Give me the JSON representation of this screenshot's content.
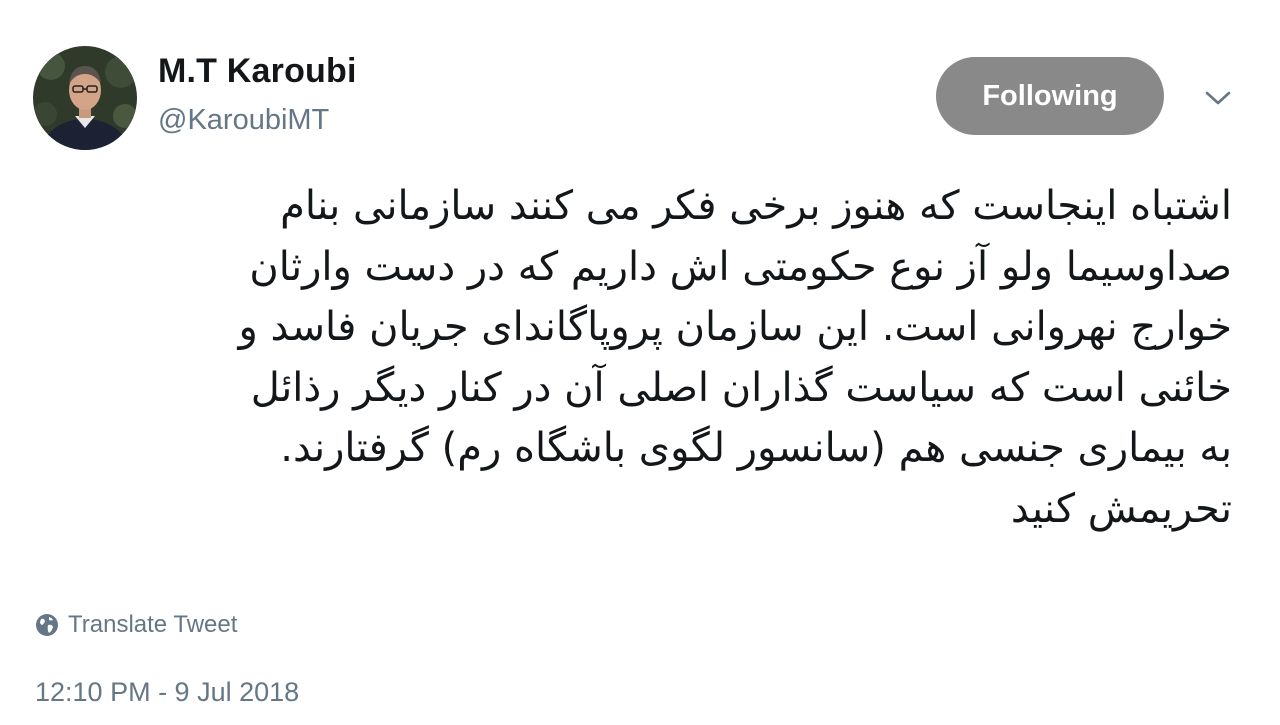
{
  "author": {
    "display_name": "M.T Karoubi",
    "handle": "@KaroubiMT",
    "avatar_icon": "profile-photo"
  },
  "follow_button": {
    "label": "Following",
    "color": "#898989"
  },
  "menu": {
    "icon": "chevron-down-icon"
  },
  "tweet": {
    "lines": [
      "اشتباه اینجاست که هنوز برخی فکر می کنند سازمانی بنام",
      "صداوسیما ولو آز نوع حکومتی اش داریم که در دست وارثان",
      "خوارج نهروانی است. این سازمان پروپاگاندای جریان فاسد و",
      "خائنی است که سیاست گذاران اصلی آن در کنار دیگر رذائل",
      "به بیماری جنسی هم (سانسور لگوی باشگاه رم) گرفتارند.",
      "تحریمش کنید"
    ]
  },
  "translate": {
    "label": "Translate Tweet",
    "icon": "globe-icon"
  },
  "timestamp": "12:10 PM - 9 Jul 2018",
  "colors": {
    "text_primary": "#14171a",
    "text_secondary": "#657786"
  }
}
